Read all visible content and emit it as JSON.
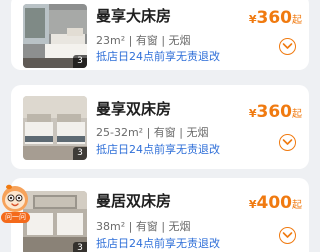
{
  "rooms": [
    {
      "name": "曼享大床房",
      "facilities": "23m² | 有窗 | 无烟",
      "policy": "抵店日24点前享无责退改",
      "currency": "¥",
      "price": "360",
      "price_suffix": "起",
      "photo_count": "3"
    },
    {
      "name": "曼享双床房",
      "facilities": "25-32m² | 有窗 | 无烟",
      "policy": "抵店日24点前享无责退改",
      "currency": "¥",
      "price": "360",
      "price_suffix": "起",
      "photo_count": "3"
    },
    {
      "name": "曼居双床房",
      "facilities": "38m² | 有窗 | 无烟",
      "policy": "抵店日24点前享无责退改",
      "currency": "¥",
      "price": "400",
      "price_suffix": "起",
      "photo_count": "3"
    }
  ],
  "mascot": {
    "tag": "问一问",
    "icon": "assistant-mascot-icon"
  },
  "colors": {
    "accent": "#f07a10",
    "link": "#2f6fd8",
    "background": "#eef0f3"
  }
}
